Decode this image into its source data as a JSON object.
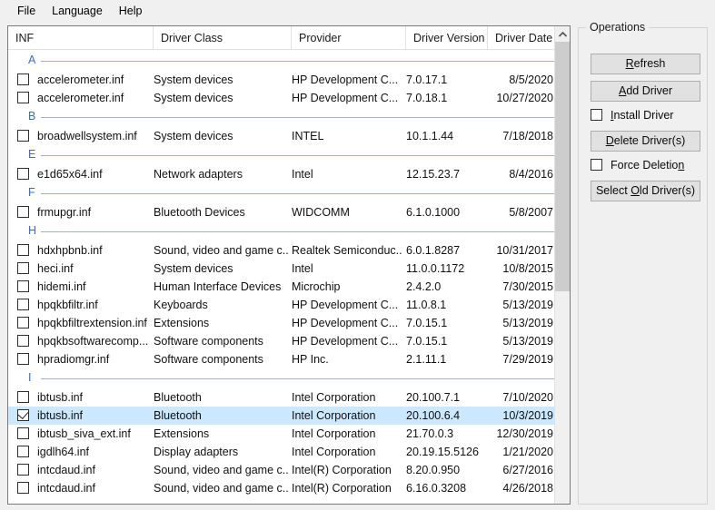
{
  "menu": {
    "items": [
      {
        "label": "File",
        "name": "menu-file"
      },
      {
        "label": "Language",
        "name": "menu-language"
      },
      {
        "label": "Help",
        "name": "menu-help"
      }
    ]
  },
  "table": {
    "columns": [
      {
        "label": "INF",
        "key": "inf"
      },
      {
        "label": "Driver Class",
        "key": "driver_class"
      },
      {
        "label": "Provider",
        "key": "provider"
      },
      {
        "label": "Driver Version",
        "key": "driver_version"
      },
      {
        "label": "Driver Date",
        "key": "driver_date"
      }
    ],
    "sort": {
      "column": "INF",
      "direction": "ascending",
      "icon": "sort-ascending-icon"
    },
    "groups": [
      {
        "letter": "A",
        "rows": [
          {
            "checked": false,
            "selected": false,
            "inf": "accelerometer.inf",
            "driver_class": "System devices",
            "provider": "HP Development C...",
            "driver_version": "7.0.17.1",
            "driver_date": "8/5/2020"
          },
          {
            "checked": false,
            "selected": false,
            "inf": "accelerometer.inf",
            "driver_class": "System devices",
            "provider": "HP Development C...",
            "driver_version": "7.0.18.1",
            "driver_date": "10/27/2020"
          }
        ]
      },
      {
        "letter": "B",
        "rows": [
          {
            "checked": false,
            "selected": false,
            "inf": "broadwellsystem.inf",
            "driver_class": "System devices",
            "provider": "INTEL",
            "driver_version": "10.1.1.44",
            "driver_date": "7/18/2018"
          }
        ]
      },
      {
        "letter": "E",
        "rows": [
          {
            "checked": false,
            "selected": false,
            "inf": "e1d65x64.inf",
            "driver_class": "Network adapters",
            "provider": "Intel",
            "driver_version": "12.15.23.7",
            "driver_date": "8/4/2016"
          }
        ]
      },
      {
        "letter": "F",
        "rows": [
          {
            "checked": false,
            "selected": false,
            "inf": "frmupgr.inf",
            "driver_class": "Bluetooth Devices",
            "provider": "WIDCOMM",
            "driver_version": "6.1.0.1000",
            "driver_date": "5/8/2007"
          }
        ]
      },
      {
        "letter": "H",
        "rows": [
          {
            "checked": false,
            "selected": false,
            "inf": "hdxhpbnb.inf",
            "driver_class": "Sound, video and game c...",
            "provider": "Realtek Semiconduc...",
            "driver_version": "6.0.1.8287",
            "driver_date": "10/31/2017"
          },
          {
            "checked": false,
            "selected": false,
            "inf": "heci.inf",
            "driver_class": "System devices",
            "provider": "Intel",
            "driver_version": "11.0.0.1172",
            "driver_date": "10/8/2015"
          },
          {
            "checked": false,
            "selected": false,
            "inf": "hidemi.inf",
            "driver_class": "Human Interface Devices",
            "provider": "Microchip",
            "driver_version": "2.4.2.0",
            "driver_date": "7/30/2015"
          },
          {
            "checked": false,
            "selected": false,
            "inf": "hpqkbfiltr.inf",
            "driver_class": "Keyboards",
            "provider": "HP Development C...",
            "driver_version": "11.0.8.1",
            "driver_date": "5/13/2019"
          },
          {
            "checked": false,
            "selected": false,
            "inf": "hpqkbfiltrextension.inf",
            "driver_class": "Extensions",
            "provider": "HP Development C...",
            "driver_version": "7.0.15.1",
            "driver_date": "5/13/2019"
          },
          {
            "checked": false,
            "selected": false,
            "inf": "hpqkbsoftwarecomp...",
            "driver_class": "Software components",
            "provider": "HP Development C...",
            "driver_version": "7.0.15.1",
            "driver_date": "5/13/2019"
          },
          {
            "checked": false,
            "selected": false,
            "inf": "hpradiomgr.inf",
            "driver_class": "Software components",
            "provider": "HP Inc.",
            "driver_version": "2.1.11.1",
            "driver_date": "7/29/2019"
          }
        ]
      },
      {
        "letter": "I",
        "rows": [
          {
            "checked": false,
            "selected": false,
            "inf": "ibtusb.inf",
            "driver_class": "Bluetooth",
            "provider": "Intel Corporation",
            "driver_version": "20.100.7.1",
            "driver_date": "7/10/2020"
          },
          {
            "checked": true,
            "selected": true,
            "inf": "ibtusb.inf",
            "driver_class": "Bluetooth",
            "provider": "Intel Corporation",
            "driver_version": "20.100.6.4",
            "driver_date": "10/3/2019"
          },
          {
            "checked": false,
            "selected": false,
            "inf": "ibtusb_siva_ext.inf",
            "driver_class": "Extensions",
            "provider": "Intel Corporation",
            "driver_version": "21.70.0.3",
            "driver_date": "12/30/2019"
          },
          {
            "checked": false,
            "selected": false,
            "inf": "igdlh64.inf",
            "driver_class": "Display adapters",
            "provider": "Intel Corporation",
            "driver_version": "20.19.15.5126",
            "driver_date": "1/21/2020"
          },
          {
            "checked": false,
            "selected": false,
            "inf": "intcdaud.inf",
            "driver_class": "Sound, video and game c...",
            "provider": "Intel(R) Corporation",
            "driver_version": "8.20.0.950",
            "driver_date": "6/27/2016"
          },
          {
            "checked": false,
            "selected": false,
            "inf": "intcdaud.inf",
            "driver_class": "Sound, video and game c...",
            "provider": "Intel(R) Corporation",
            "driver_version": "6.16.0.3208",
            "driver_date": "4/26/2018"
          }
        ]
      }
    ]
  },
  "scrollbar": {
    "up_icon": "chevron-up-icon",
    "thumb_top_pct": 0,
    "thumb_height_pct": 54
  },
  "operations": {
    "legend": "Operations",
    "controls": [
      {
        "type": "button",
        "name": "refresh-button",
        "label": "Refresh",
        "accel": "R",
        "accel_index": 0
      },
      {
        "type": "button",
        "name": "add-driver-button",
        "label": "Add Driver",
        "accel": "A",
        "accel_index": 0
      },
      {
        "type": "checkbox",
        "name": "install-driver-checkbox",
        "label": "Install Driver",
        "accel": "I",
        "accel_index": 0,
        "checked": false
      },
      {
        "type": "button",
        "name": "delete-drivers-button",
        "label": "Delete Driver(s)",
        "accel": "D",
        "accel_index": 0
      },
      {
        "type": "checkbox",
        "name": "force-deletion-checkbox",
        "label": "Force Deletion",
        "accel": "n",
        "accel_index": 13,
        "checked": false
      },
      {
        "type": "button",
        "name": "select-old-drivers-button",
        "label": "Select Old Driver(s)",
        "accel": "O",
        "accel_index": 7
      }
    ]
  },
  "colors": {
    "window_bg": "#f0f0f0",
    "list_bg": "#ffffff",
    "selection": "#cce8ff",
    "group_letter": "#3f6dad",
    "group_line": "#97b3d9",
    "button_bg": "#e1e1e1",
    "button_border": "#adadad",
    "scrollbar_thumb": "#cdcdcd"
  }
}
